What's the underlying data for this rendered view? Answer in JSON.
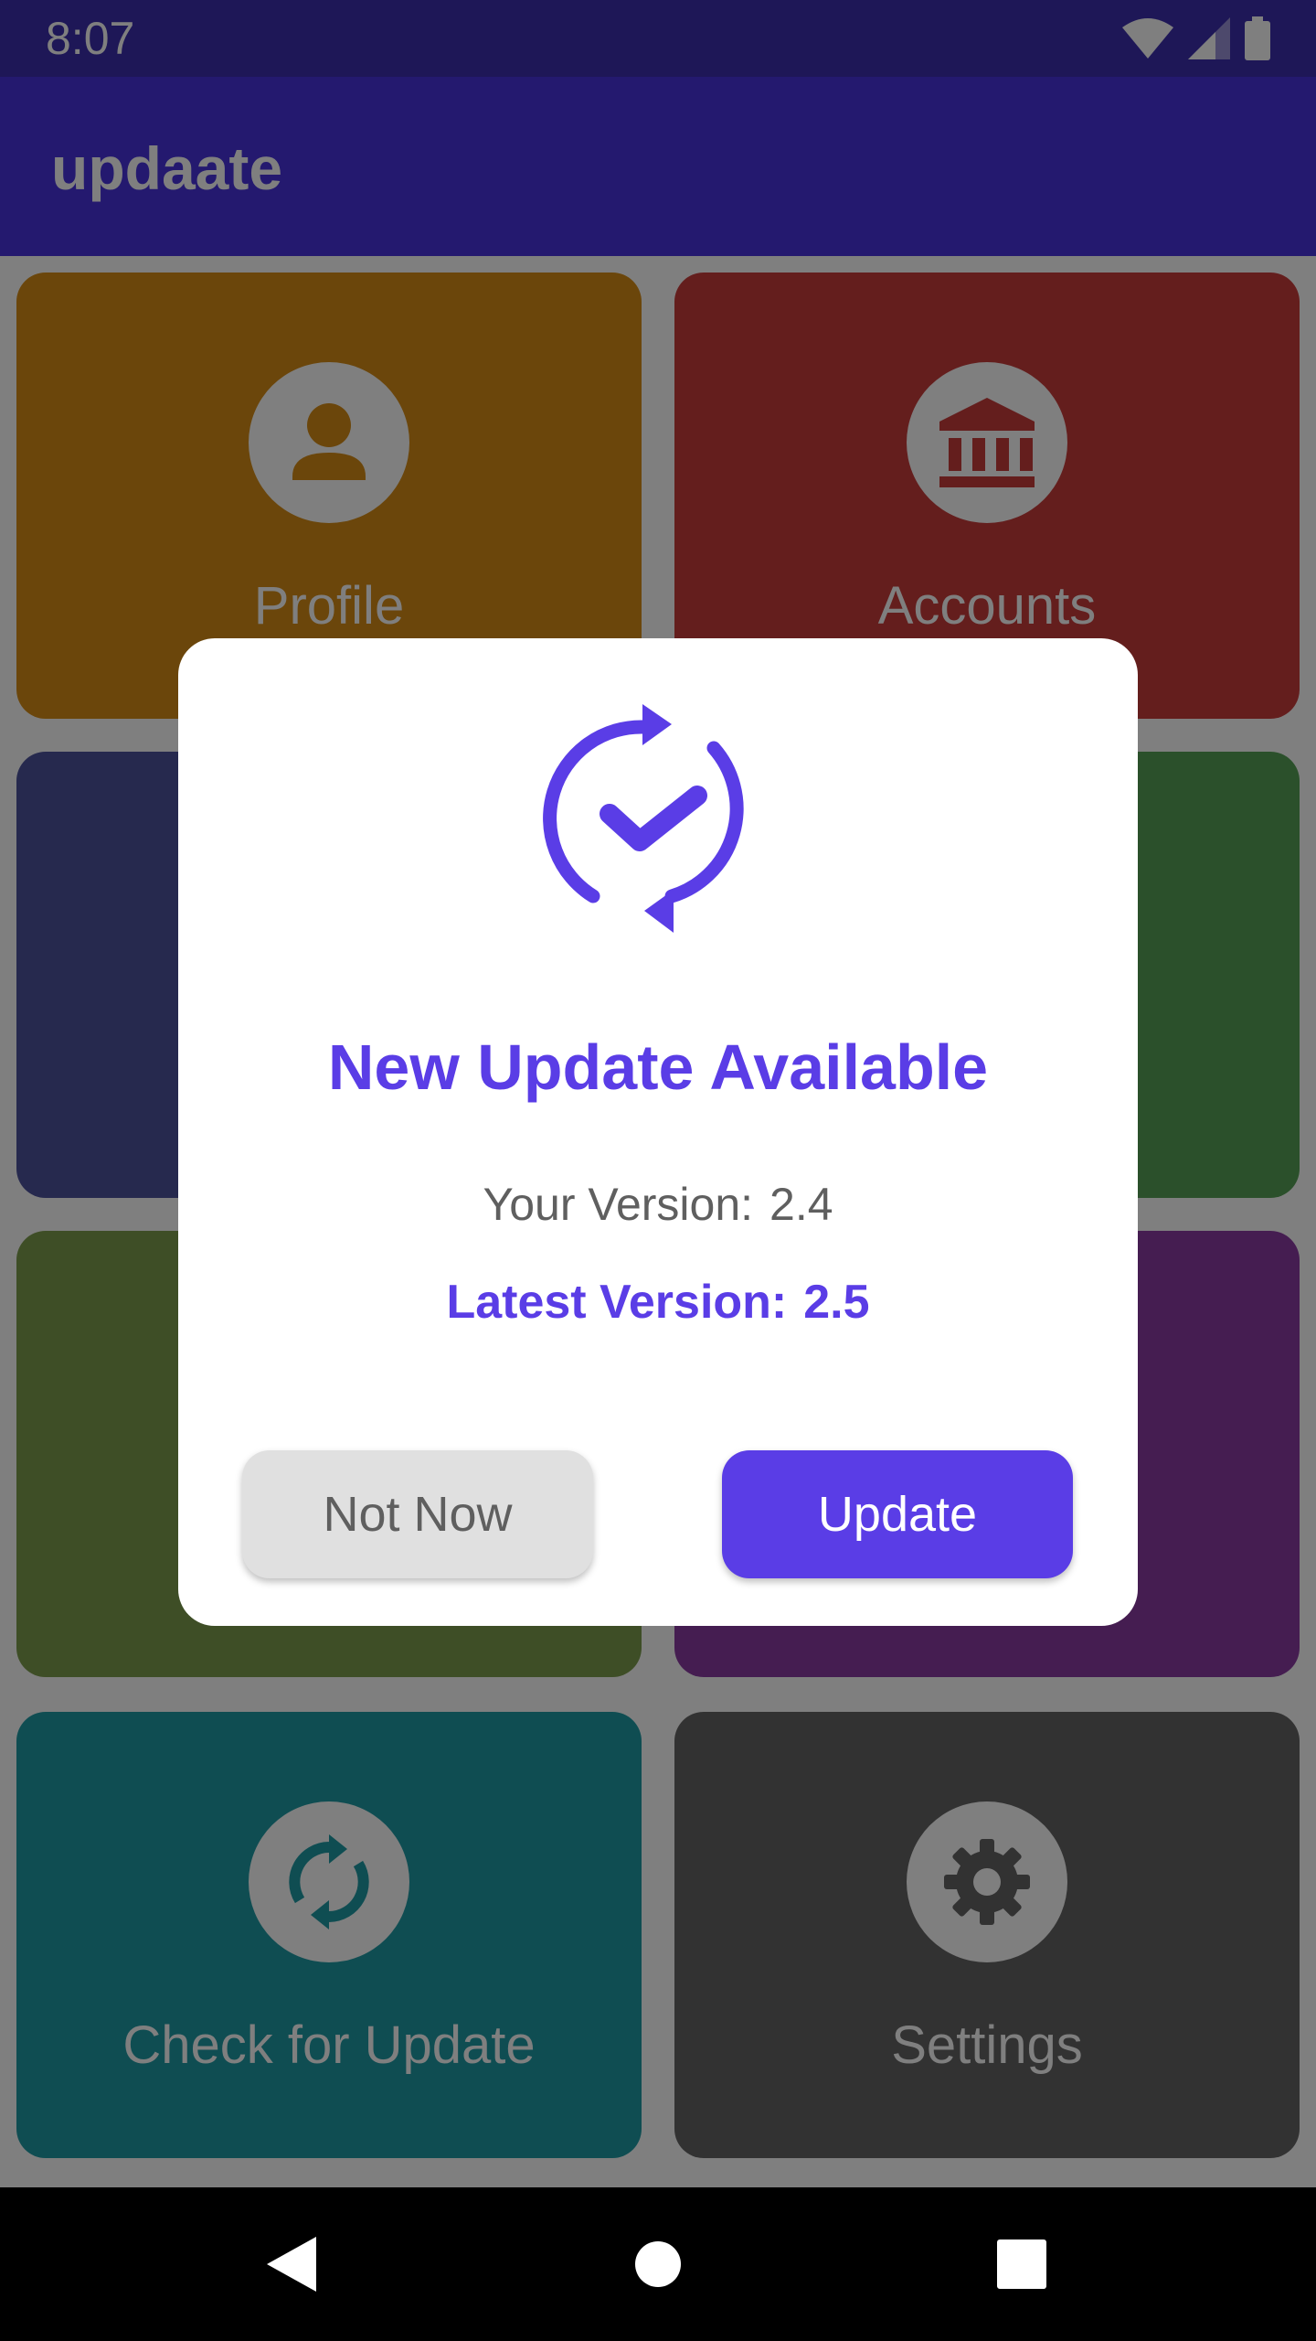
{
  "status_bar": {
    "time": "8:07",
    "icons": [
      "wifi-icon",
      "cell-signal-icon",
      "battery-icon"
    ]
  },
  "app_bar": {
    "title": "updaate",
    "color": "#4833de"
  },
  "tiles": [
    {
      "label": "Profile",
      "icon": "person-icon",
      "color": "#d68c17"
    },
    {
      "label": "Accounts",
      "icon": "bank-icon",
      "color": "#c83c3b"
    },
    {
      "label": "",
      "color": "#4c539c"
    },
    {
      "label": "",
      "color": "#56a156"
    },
    {
      "label": "",
      "color": "#7d9c4d"
    },
    {
      "label": "",
      "color": "#8b3aa2"
    },
    {
      "label": "Check for Update",
      "icon": "sync-icon",
      "color": "#1e9aa5"
    },
    {
      "label": "Settings",
      "icon": "gear-icon",
      "color": "#646464"
    }
  ],
  "dialog": {
    "icon": "update-check-icon",
    "title": "New Update Available",
    "your_version_label": "Your Version:",
    "your_version_value": "2.4",
    "latest_version_label": "Latest Version:",
    "latest_version_value": "2.5",
    "not_now_label": "Not Now",
    "update_label": "Update",
    "accent_color": "#5a3de6"
  },
  "nav_bar": {
    "icons": [
      "back-icon",
      "home-icon",
      "recents-icon"
    ]
  }
}
